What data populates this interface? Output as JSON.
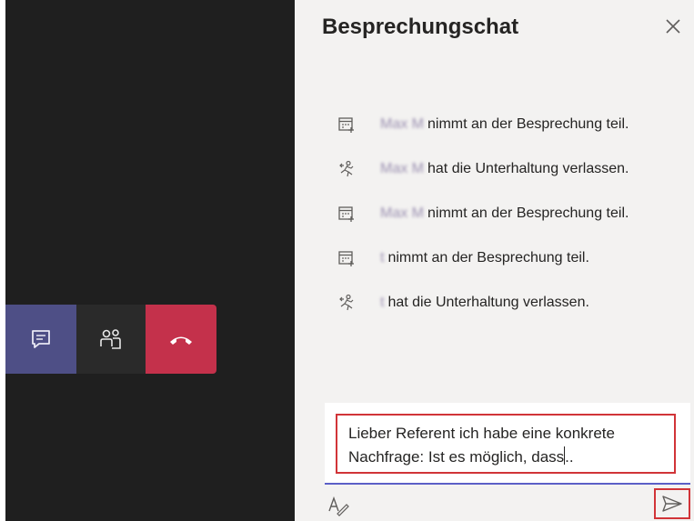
{
  "chat_panel": {
    "title": "Besprechungschat",
    "events": [
      {
        "icon": "calendar-join-icon",
        "name": "Max M",
        "text": "nimmt an der Besprechung teil."
      },
      {
        "icon": "person-leave-icon",
        "name": "Max M",
        "text": "hat die Unterhaltung verlassen."
      },
      {
        "icon": "calendar-join-icon",
        "name": "Max M",
        "text": "nimmt an der Besprechung teil."
      },
      {
        "icon": "calendar-join-icon",
        "name": "t",
        "text": "nimmt an der Besprechung teil."
      },
      {
        "icon": "person-leave-icon",
        "name": "t",
        "text": "hat die Unterhaltung verlassen."
      }
    ],
    "compose": {
      "line1": "Lieber Referent ich habe eine konkrete",
      "line2_before_caret": "Nachfrage: Ist es möglich, dass",
      "line2_after_caret": ".."
    }
  },
  "call_bar": {
    "buttons": [
      "chat-icon",
      "participants-icon",
      "hang-up-icon"
    ]
  },
  "colors": {
    "stage_bg": "#1f1f1f",
    "chat_button_active": "#4e4f86",
    "hangup": "#c4314b",
    "highlight_border": "#d13438",
    "accent": "#5b5fc7"
  }
}
